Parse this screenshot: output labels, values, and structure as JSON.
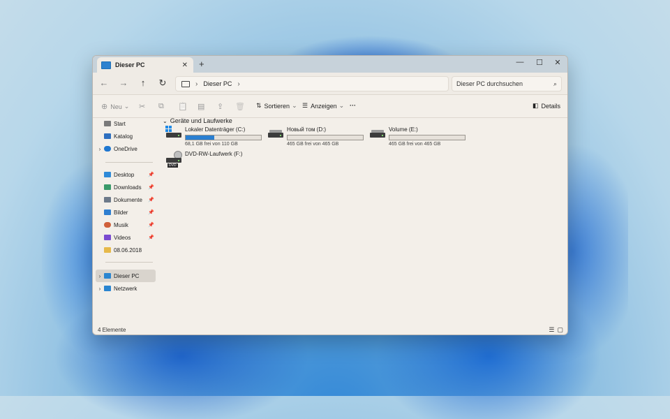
{
  "window": {
    "tab_title": "Dieser PC",
    "new_tab": "+",
    "close_tab": "✕",
    "controls": {
      "minimize": "—",
      "maximize": "☐",
      "close": "✕"
    }
  },
  "address": {
    "back": "←",
    "forward": "→",
    "up": "↑",
    "refresh": "↻",
    "path_root": "›",
    "path": "Dieser PC",
    "path_next": "›",
    "search_placeholder": "Dieser PC durchsuchen",
    "search_icon": "⌕"
  },
  "toolbar": {
    "new_label": "Neu",
    "sort_label": "Sortieren",
    "view_label": "Anzeigen",
    "more_label": "···",
    "details_label": "Details",
    "icons": {
      "new": "⊕",
      "cut": "✂",
      "copy": "⧉",
      "paste": "📋",
      "rename": "▤",
      "share": "⇪",
      "delete": "🗑",
      "sort": "⇅",
      "view": "☰",
      "details": "◧",
      "chevron": "⌄"
    }
  },
  "sidebar": {
    "items": [
      {
        "label": "Start",
        "icon": "home-icon",
        "color": "#7a7a7a"
      },
      {
        "label": "Katalog",
        "icon": "gallery-icon",
        "color": "#2e6fbf"
      },
      {
        "label": "OneDrive",
        "icon": "cloud-icon",
        "color": "#1f77d0",
        "chev": "›"
      },
      {
        "label": "Desktop",
        "icon": "desktop-icon",
        "color": "#2e8ad8",
        "pin": "📌"
      },
      {
        "label": "Downloads",
        "icon": "download-icon",
        "color": "#3a9a6a",
        "pin": "📌"
      },
      {
        "label": "Dokumente",
        "icon": "document-icon",
        "color": "#6d7a8a",
        "pin": "📌"
      },
      {
        "label": "Bilder",
        "icon": "pictures-icon",
        "color": "#2f7fd0",
        "pin": "📌"
      },
      {
        "label": "Musik",
        "icon": "music-icon",
        "color": "#d0603a",
        "pin": "📌"
      },
      {
        "label": "Videos",
        "icon": "videos-icon",
        "color": "#7a4bd0",
        "pin": "📌"
      },
      {
        "label": "08.06.2018",
        "icon": "folder-icon",
        "color": "#e6b94a"
      },
      {
        "label": "Dieser PC",
        "icon": "pc-icon",
        "color": "#2a85d0",
        "chev": "›"
      },
      {
        "label": "Netzwerk",
        "icon": "network-icon",
        "color": "#2a85d0",
        "chev": "›"
      }
    ]
  },
  "content": {
    "group_title": "Geräte und Laufwerke",
    "group_chevron": "⌄",
    "drives": [
      {
        "name": "Lokaler Datenträger (C:)",
        "free": "68,1 GB frei von 110 GB",
        "used_fraction": 0.38
      },
      {
        "name": "Новый том (D:)",
        "free": "465 GB frei von 465 GB",
        "used_fraction": 0.0
      },
      {
        "name": "Volume (E:)",
        "free": "465 GB frei von 465 GB",
        "used_fraction": 0.0
      },
      {
        "name": "DVD-RW-Laufwerk (F:)",
        "badge": "DVD"
      }
    ]
  },
  "status": {
    "count": "4 Elemente",
    "view_list": "☰",
    "view_tiles": "▢"
  }
}
